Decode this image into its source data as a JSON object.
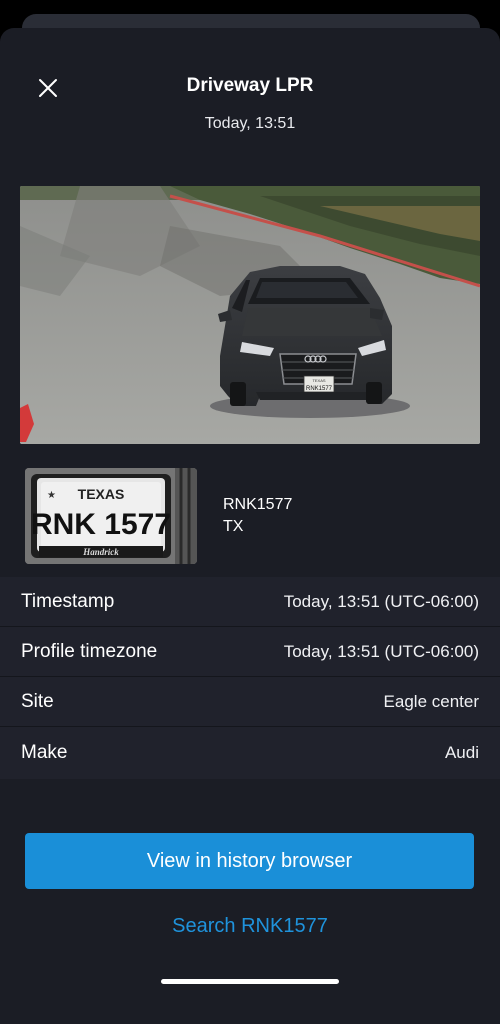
{
  "header": {
    "title": "Driveway LPR",
    "subtitle": "Today, 13:51"
  },
  "snapshot": {
    "plate_text": "RNK1577",
    "plate_state_text": "TEXAS"
  },
  "plate_crop": {
    "state_text": "TEXAS",
    "plate_text": "RNK 1577",
    "frame_text": "Handrick"
  },
  "plate": {
    "number": "RNK1577",
    "state": "TX"
  },
  "details": [
    {
      "label": "Timestamp",
      "value": "Today, 13:51  (UTC-06:00)"
    },
    {
      "label": "Profile timezone",
      "value": "Today, 13:51  (UTC-06:00)"
    },
    {
      "label": "Site",
      "value": "Eagle center"
    },
    {
      "label": "Make",
      "value": "Audi"
    }
  ],
  "actions": {
    "history_button": "View in history browser",
    "search_link": "Search RNK1577"
  },
  "colors": {
    "background": "#1b1d25",
    "accent": "#1a8fd8",
    "link": "#1f93dc"
  },
  "icons": {
    "close": "close-icon"
  }
}
